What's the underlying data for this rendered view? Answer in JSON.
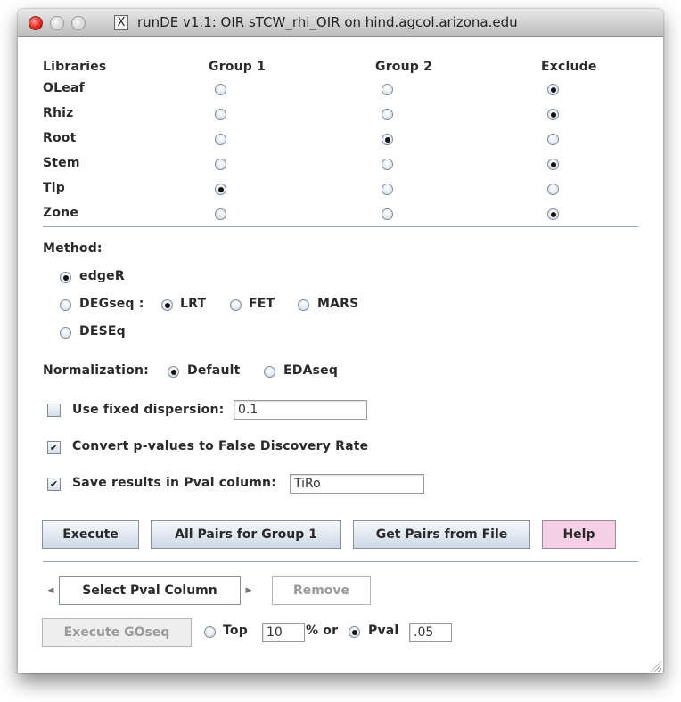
{
  "window": {
    "title": "runDE v1.1: OIR sTCW_rhi_OIR on hind.agcol.arizona.edu",
    "app_icon": "x11-icon",
    "app_icon_glyph": "X"
  },
  "libraries": {
    "headers": {
      "name": "Libraries",
      "group1": "Group 1",
      "group2": "Group 2",
      "exclude": "Exclude"
    },
    "rows": [
      {
        "name": "OLeaf",
        "selected": "exclude"
      },
      {
        "name": "Rhiz",
        "selected": "exclude"
      },
      {
        "name": "Root",
        "selected": "group2"
      },
      {
        "name": "Stem",
        "selected": "exclude"
      },
      {
        "name": "Tip",
        "selected": "group1"
      },
      {
        "name": "Zone",
        "selected": "exclude"
      }
    ]
  },
  "method": {
    "label": "Method:",
    "options": {
      "edger": "edgeR",
      "degseq": "DEGseq :",
      "deseq": "DESEq"
    },
    "selected": "edgeR",
    "degseq_sub": {
      "lrt": "LRT",
      "fet": "FET",
      "mars": "MARS",
      "selected": "LRT"
    }
  },
  "normalization": {
    "label": "Normalization:",
    "options": {
      "default": "Default",
      "edaseq": "EDAseq"
    },
    "selected": "Default"
  },
  "options": {
    "fixed_dispersion": {
      "label": "Use fixed dispersion:",
      "checked": false,
      "value": "0.1"
    },
    "fdr": {
      "label": "Convert p-values to False Discovery Rate",
      "checked": true
    },
    "save_pval": {
      "label": "Save results in Pval column:",
      "checked": true,
      "value": "TiRo"
    }
  },
  "buttons": {
    "execute": "Execute",
    "all_pairs": "All Pairs for Group 1",
    "pairs_file": "Get Pairs from File",
    "help": "Help",
    "remove": "Remove",
    "execute_goseq": "Execute GOseq"
  },
  "goseq": {
    "pval_column_selector": "Select Pval Column",
    "top_label": "Top",
    "top_value": "10",
    "percent_or": "% or",
    "pval_label": "Pval",
    "pval_value": ".05",
    "selected": "Pval"
  },
  "colors": {
    "help_bg": "#f5cfe6",
    "separator": "#8fa6cc"
  }
}
